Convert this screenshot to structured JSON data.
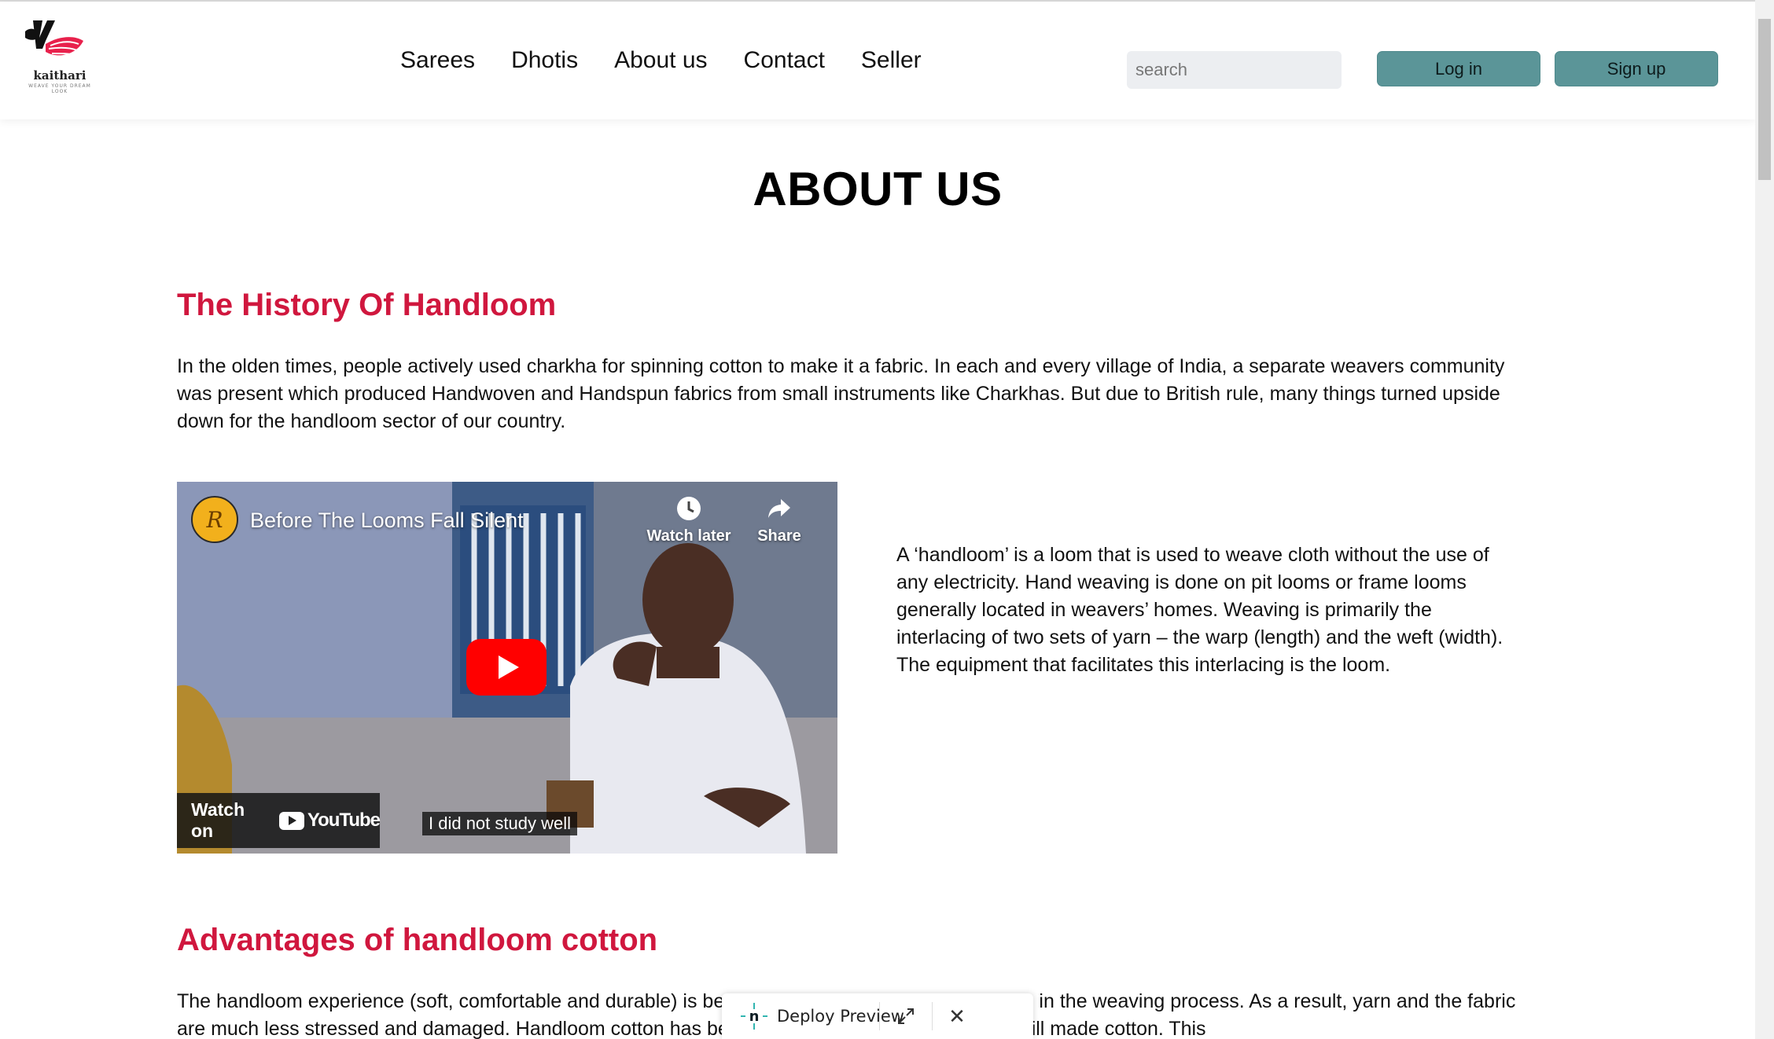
{
  "brand": {
    "name": "kaithari",
    "tagline": "WEAVE YOUR DREAM LOOK"
  },
  "nav": {
    "items": [
      "Sarees",
      "Dhotis",
      "About us",
      "Contact",
      "Seller"
    ]
  },
  "search": {
    "placeholder": "search",
    "value": ""
  },
  "auth": {
    "login_label": "Log in",
    "signup_label": "Sign up"
  },
  "page": {
    "title": "ABOUT US"
  },
  "sections": [
    {
      "title": "The History Of Handloom",
      "paragraph": "In the olden times, people actively used charkha for spinning cotton to make it a fabric. In each and every village of India, a separate weavers community was present which produced Handwoven and Handspun fabrics from small instruments like Charkhas. But due to British rule, many things turned upside down for the handloom sector of our country."
    },
    {
      "title": "Advantages of handloom cotton",
      "paragraph": "The handloom experience (soft, comfortable and durable) is because of less stress put on the yarn in the weaving process. As a result, yarn and the fabric are much less stressed and damaged. Handloom cotton has better breathability as compared to mill made cotton. This"
    }
  ],
  "handloom_text": "A ‘handloom’ is a loom that is used to weave cloth without the use of any electricity. Hand weaving is done on pit looms or frame looms generally located in weavers’ homes. Weaving is primarily the interlacing of two sets of yarn – the warp (length) and the weft (width). The equipment that facilitates this interlacing is the loom.",
  "video": {
    "title": "Before The Looms Fall Silent",
    "channel_initial": "R",
    "watch_later_label": "Watch later",
    "share_label": "Share",
    "watch_on_label": "Watch on",
    "youtube_word": "YouTube",
    "caption": "I did not study well"
  },
  "deploy_preview": {
    "label": "Deploy Preview",
    "close_symbol": "✕"
  },
  "colors": {
    "accent_red": "#d0173e",
    "button_teal": "#5b9598",
    "youtube_red": "#ff0000"
  }
}
